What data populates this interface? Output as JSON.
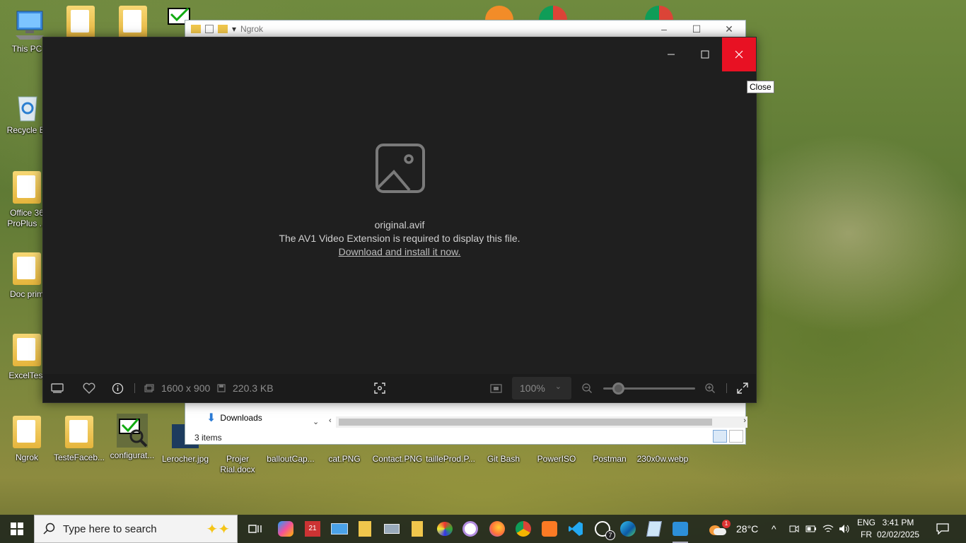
{
  "desktop": {
    "left_icons": [
      {
        "label": "This PC"
      },
      {
        "label": "Recycle Bi"
      },
      {
        "label": "Office 36\nProPlus ..."
      },
      {
        "label": "Doc prim"
      },
      {
        "label": "ExcelTest"
      },
      {
        "label": "Ngrok"
      }
    ],
    "bottom_icons": [
      {
        "label": "TesteFaceb..."
      },
      {
        "label": "configurat..."
      },
      {
        "label": "Lerocher.jpg"
      },
      {
        "label": "Projer\nRial.docx"
      },
      {
        "label": "balloutCap..."
      },
      {
        "label": "cat.PNG"
      },
      {
        "label": "Contact.PNG"
      },
      {
        "label": "tailleProd.P..."
      },
      {
        "label": "Git Bash"
      },
      {
        "label": "PowerISO"
      },
      {
        "label": "Postman"
      },
      {
        "label": "230x0w.webp"
      }
    ]
  },
  "explorer": {
    "title": "Ngrok",
    "nav_item": "Downloads",
    "status": "3 items"
  },
  "viewer": {
    "tooltip": "Close",
    "filename": "original.avif",
    "message": "The AV1 Video Extension is required to display this file.",
    "link": "Download and install it now.",
    "dimensions": "1600 x 900",
    "filesize": "220.3 KB",
    "zoom": "100%"
  },
  "taskbar": {
    "search_placeholder": "Type here to search",
    "weather_temp": "28°C",
    "lang_top": "ENG",
    "lang_bottom": "FR",
    "time": "3:41 PM",
    "date": "02/02/2025",
    "calendar_badge": "21",
    "whatsapp_badge": "7",
    "weather_badge": "1"
  },
  "colors": {
    "close_red": "#e81123",
    "viewer_bg": "#1f1f1f",
    "taskbar_bg": "#242a1e"
  }
}
